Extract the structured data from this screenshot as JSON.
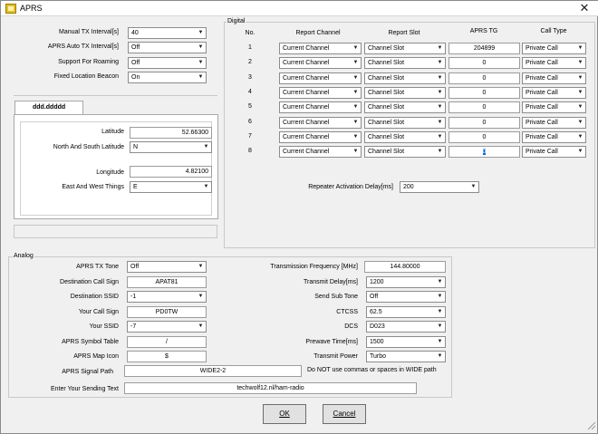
{
  "window": {
    "title": "APRS",
    "close_glyph": "✕"
  },
  "left": {
    "rows": [
      {
        "label": "Manual TX Interval[s]",
        "value": "40"
      },
      {
        "label": "APRS Auto TX Interval[s]",
        "value": "Off"
      },
      {
        "label": "Support For Roaming",
        "value": "Off"
      },
      {
        "label": "Fixed Location Beacon",
        "value": "On"
      }
    ],
    "tab_label": "ddd.ddddd",
    "latitude_label": "Latitude",
    "latitude_value": "52.66300",
    "ns_label": "North And South Latitude",
    "ns_value": "N",
    "longitude_label": "Longitude",
    "longitude_value": "4.82100",
    "ew_label": "East And West Things",
    "ew_value": "E"
  },
  "digital": {
    "group_label": "Digital",
    "headers": {
      "no": "No.",
      "report_channel": "Report Channel",
      "report_slot": "Report Slot",
      "tg": "APRS TG",
      "call_type": "Call Type"
    },
    "rows": [
      {
        "no": "1",
        "channel": "Current Channel",
        "slot": "Channel Slot",
        "tg": "204899",
        "call_type": "Private Call"
      },
      {
        "no": "2",
        "channel": "Current Channel",
        "slot": "Channel Slot",
        "tg": "0",
        "call_type": "Private Call"
      },
      {
        "no": "3",
        "channel": "Current Channel",
        "slot": "Channel Slot",
        "tg": "0",
        "call_type": "Private Call"
      },
      {
        "no": "4",
        "channel": "Current Channel",
        "slot": "Channel Slot",
        "tg": "0",
        "call_type": "Private Call"
      },
      {
        "no": "5",
        "channel": "Current Channel",
        "slot": "Channel Slot",
        "tg": "0",
        "call_type": "Private Call"
      },
      {
        "no": "6",
        "channel": "Current Channel",
        "slot": "Channel Slot",
        "tg": "0",
        "call_type": "Private Call"
      },
      {
        "no": "7",
        "channel": "Current Channel",
        "slot": "Channel Slot",
        "tg": "0",
        "call_type": "Private Call"
      },
      {
        "no": "8",
        "channel": "Current Channel",
        "slot": "Channel Slot",
        "tg": "0",
        "call_type": "Private Call"
      }
    ],
    "repeater_label": "Repeater Activation Delay[ms]",
    "repeater_value": "200"
  },
  "analog": {
    "group_label": "Analog",
    "aprs_tx_tone_label": "APRS TX Tone",
    "aprs_tx_tone_value": "Off",
    "dest_call_label": "Destination Call Sign",
    "dest_call_value": "APAT81",
    "dest_ssid_label": "Destination SSID",
    "dest_ssid_value": "-1",
    "your_call_label": "Your Call Sign",
    "your_call_value": "PD0TW",
    "your_ssid_label": "Your SSID",
    "your_ssid_value": "-7",
    "symbol_table_label": "APRS Symbol Table",
    "symbol_table_value": "/",
    "map_icon_label": "APRS Map Icon",
    "map_icon_value": "$",
    "signal_path_label": "APRS Signal Path",
    "signal_path_value": "WIDE2-2",
    "signal_path_note": "Do NOT use commas or spaces in WIDE path",
    "sending_text_label": "Enter Your Sending Text",
    "sending_text_value": "techwolf12.nl/ham-radio",
    "tx_freq_label": "Transmission Frequency [MHz]",
    "tx_freq_value": "144.80000",
    "tx_delay_label": "Transmit Delay[ms]",
    "tx_delay_value": "1200",
    "send_subtone_label": "Send Sub Tone",
    "send_subtone_value": "Off",
    "ctcss_label": "CTCSS",
    "ctcss_value": "62.5",
    "dcs_label": "DCS",
    "dcs_value": "D023",
    "prewave_label": "Prewave Time[ms]",
    "prewave_value": "1500",
    "tx_power_label": "Transmit Power",
    "tx_power_value": "Turbo"
  },
  "buttons": {
    "ok": "OK",
    "cancel": "Cancel"
  }
}
